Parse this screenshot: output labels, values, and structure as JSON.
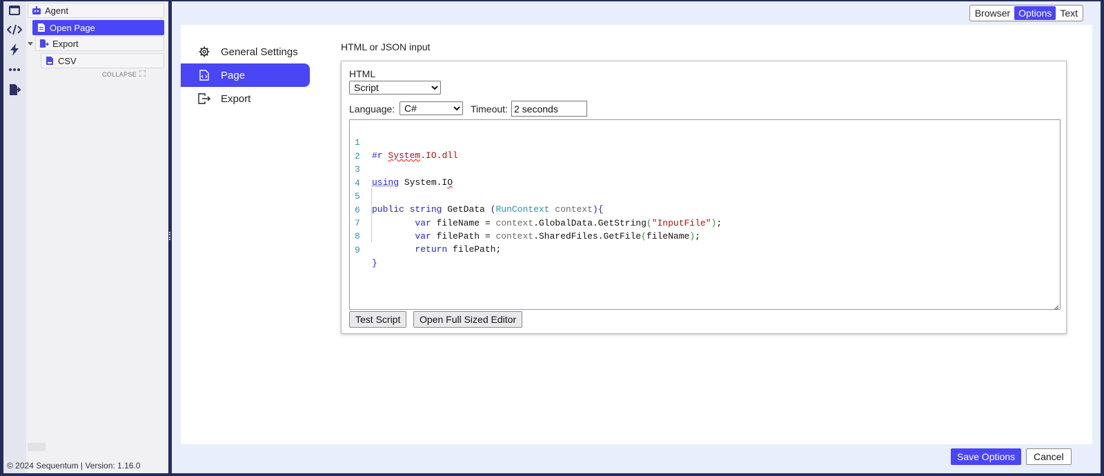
{
  "rail": {
    "icons": [
      "window-icon",
      "code-icon",
      "lightning-icon",
      "more-icon",
      "export-file-icon"
    ]
  },
  "tree": {
    "items": [
      {
        "label": "Agent",
        "icon": "robot-icon"
      },
      {
        "label": "Open Page",
        "icon": "page-icon",
        "selected": true
      },
      {
        "label": "Export",
        "icon": "export-file-icon"
      },
      {
        "label": "CSV",
        "icon": "csv-file-icon"
      }
    ],
    "collapse_label": "COLLAPSE",
    "footer": "© 2024 Sequentum | Version: 1.16.0"
  },
  "view_switch": {
    "browser": "Browser",
    "options": "Options",
    "text": "Text",
    "active": "Options"
  },
  "nav": {
    "items": [
      {
        "label": "General Settings",
        "icon": "gear-icon"
      },
      {
        "label": "Page",
        "icon": "code-file-icon",
        "active": true
      },
      {
        "label": "Export",
        "icon": "export-icon"
      }
    ]
  },
  "section": {
    "title": "HTML or JSON input",
    "html_label": "HTML",
    "html_mode": "Script",
    "language_label": "Language:",
    "language": "C#",
    "timeout_label": "Timeout:",
    "timeout_value": "2 seconds"
  },
  "editor": {
    "lines": [
      {
        "n": "1",
        "text": "#r System.IO.dll"
      },
      {
        "n": "2",
        "text": ""
      },
      {
        "n": "3",
        "text": "using System.IO"
      },
      {
        "n": "4",
        "text": ""
      },
      {
        "n": "5",
        "text": "public string GetData (RunContext context){"
      },
      {
        "n": "6",
        "text": "        var fileName = context.GlobalData.GetString(\"InputFile\");"
      },
      {
        "n": "7",
        "text": "        var filePath = context.SharedFiles.GetFile(fileName);"
      },
      {
        "n": "8",
        "text": "        return filePath;"
      },
      {
        "n": "9",
        "text": "}"
      }
    ]
  },
  "buttons": {
    "test_script": "Test Script",
    "open_full_editor": "Open Full Sized Editor",
    "save_options": "Save Options",
    "cancel": "Cancel"
  },
  "colors": {
    "accent": "#4a45f5",
    "rail_bg": "#e4e6ef",
    "frame": "#232d5c"
  }
}
